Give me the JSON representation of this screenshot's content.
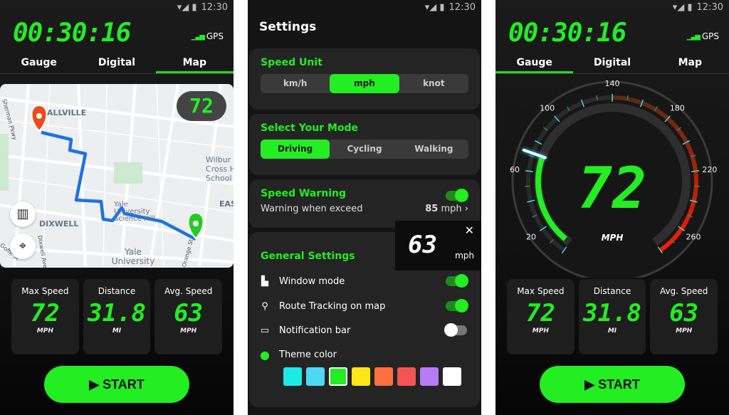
{
  "status": {
    "time": "12:30"
  },
  "screens": {
    "map": {
      "timer": "00:30:16",
      "gps": "GPS",
      "tabs": [
        "Gauge",
        "Digital",
        "Map"
      ],
      "active_tab": "Map",
      "map_speed": "72",
      "map_labels": [
        "ALLVILLE",
        "Wilbur Cross High School",
        "EAST",
        "DIXWELL",
        "Yale University Science Hill",
        "Yale University",
        "Orange St",
        "Dixwell Ave",
        "Sherman Pkwy",
        "Goffe St"
      ],
      "stats": [
        {
          "label": "Max Speed",
          "value": "72",
          "unit": "MPH"
        },
        {
          "label": "Distance",
          "value": "31.8",
          "unit": "MI"
        },
        {
          "label": "Avg. Speed",
          "value": "63",
          "unit": "MPH"
        }
      ],
      "start": "START"
    },
    "settings": {
      "title": "Settings",
      "speed_unit": {
        "title": "Speed Unit",
        "options": [
          "km/h",
          "mph",
          "knot"
        ],
        "selected": "mph"
      },
      "mode": {
        "title": "Select Your Mode",
        "options": [
          "Driving",
          "Cycling",
          "Walking"
        ],
        "selected": "Driving"
      },
      "warning": {
        "title": "Speed Warning",
        "enabled": true,
        "label": "Warning when exceed",
        "value": "85",
        "unit": "mph"
      },
      "popup": {
        "value": "63",
        "unit": "mph"
      },
      "general": {
        "title": "General Settings",
        "items": [
          {
            "label": "Window mode",
            "on": true
          },
          {
            "label": "Route Tracking on map",
            "on": true
          },
          {
            "label": "Notification bar",
            "on": false
          },
          {
            "label": "Theme color"
          }
        ],
        "theme_colors": [
          "#1de9e6",
          "#4dd8f5",
          "#22ee22",
          "#ffe51a",
          "#ff7040",
          "#f45454",
          "#b77bf5",
          "#ffffff"
        ],
        "selected_color": "#22ee22"
      }
    },
    "gauge": {
      "timer": "00:30:16",
      "gps": "GPS",
      "tabs": [
        "Gauge",
        "Digital",
        "Map"
      ],
      "active_tab": "Gauge",
      "speed": 72,
      "speed_text": "72",
      "unit": "MPH",
      "scale_labels": [
        "20",
        "60",
        "100",
        "140",
        "180",
        "220",
        "260"
      ],
      "stats": [
        {
          "label": "Max Speed",
          "value": "72",
          "unit": "MPH"
        },
        {
          "label": "Distance",
          "value": "31.8",
          "unit": "MI"
        },
        {
          "label": "Avg. Speed",
          "value": "63",
          "unit": "MPH"
        }
      ],
      "start": "START"
    }
  },
  "colors": {
    "accent": "#22ee22",
    "route": "#1a73e8",
    "start_pin": "#f04a1a",
    "end_pin": "#22cc22"
  }
}
